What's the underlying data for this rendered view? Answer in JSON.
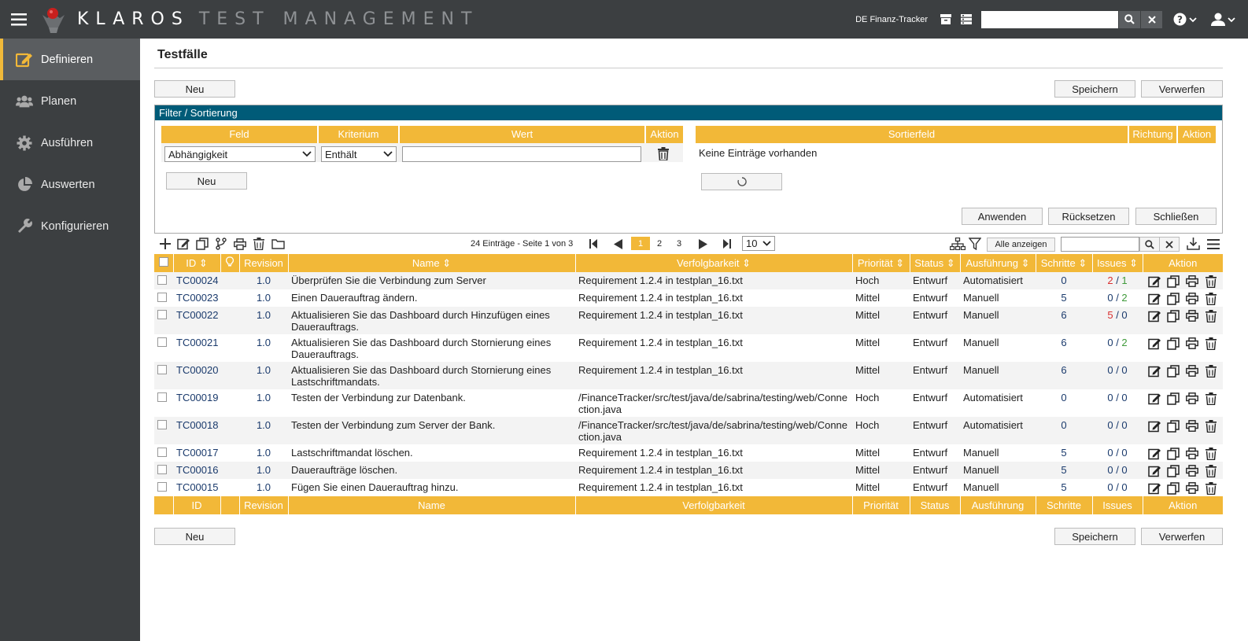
{
  "app": {
    "logo_brand": "KLAROS",
    "logo_product": "TEST MANAGEMENT",
    "project": "DE Finanz-Tracker",
    "search_value": ""
  },
  "sidebar": {
    "items": [
      {
        "label": "Definieren",
        "icon": "edit-icon",
        "active": true
      },
      {
        "label": "Planen",
        "icon": "users-icon",
        "active": false
      },
      {
        "label": "Ausführen",
        "icon": "gear-icon",
        "active": false
      },
      {
        "label": "Auswerten",
        "icon": "pie-chart-icon",
        "active": false
      },
      {
        "label": "Konfigurieren",
        "icon": "wrench-icon",
        "active": false
      }
    ]
  },
  "page": {
    "title": "Testfälle",
    "new_label": "Neu",
    "save_label": "Speichern",
    "discard_label": "Verwerfen"
  },
  "filter": {
    "header": "Filter / Sortierung",
    "col_field": "Feld",
    "col_criterion": "Kriterium",
    "col_value": "Wert",
    "col_action": "Aktion",
    "field_value": "Abhängigkeit",
    "criterion_value": "Enthält",
    "value_text": "",
    "new_label": "Neu",
    "sort_col_field": "Sortierfeld",
    "sort_col_direction": "Richtung",
    "sort_col_action": "Aktion",
    "no_entries": "Keine Einträge vorhanden",
    "apply_label": "Anwenden",
    "reset_label": "Rücksetzen",
    "close_label": "Schließen"
  },
  "pager": {
    "summary": "24 Einträge - Seite 1 von 3",
    "pages": [
      "1",
      "2",
      "3"
    ],
    "current_page": "1",
    "page_size": "10",
    "show_all_label": "Alle anzeigen",
    "table_search_value": ""
  },
  "table": {
    "headers": {
      "id": "ID",
      "revision": "Revision",
      "name": "Name",
      "traceability": "Verfolgbarkeit",
      "priority": "Priorität",
      "status": "Status",
      "execution": "Ausführung",
      "steps": "Schritte",
      "issues": "Issues",
      "action": "Aktion"
    },
    "rows": [
      {
        "id": "TC00024",
        "revision": "1.0",
        "name": "Überprüfen Sie die Verbindung zum Server",
        "traceability": "Requirement 1.2.4 in testplan_16.txt",
        "priority": "Hoch",
        "status": "Entwurf",
        "execution": "Automatisiert",
        "steps": "0",
        "issues_a": "2",
        "issues_b": "1"
      },
      {
        "id": "TC00023",
        "revision": "1.0",
        "name": "Einen Dauerauftrag ändern.",
        "traceability": "Requirement 1.2.4 in testplan_16.txt",
        "priority": "Mittel",
        "status": "Entwurf",
        "execution": "Manuell",
        "steps": "5",
        "issues_a": "0",
        "issues_b": "2"
      },
      {
        "id": "TC00022",
        "revision": "1.0",
        "name": "Aktualisieren Sie das Dashboard durch Hinzufügen eines Dauerauftrags.",
        "traceability": "Requirement 1.2.4 in testplan_16.txt",
        "priority": "Mittel",
        "status": "Entwurf",
        "execution": "Manuell",
        "steps": "6",
        "issues_a": "5",
        "issues_b": "0"
      },
      {
        "id": "TC00021",
        "revision": "1.0",
        "name": "Aktualisieren Sie das Dashboard durch Stornierung eines Dauerauftrags.",
        "traceability": "Requirement 1.2.4 in testplan_16.txt",
        "priority": "Mittel",
        "status": "Entwurf",
        "execution": "Manuell",
        "steps": "6",
        "issues_a": "0",
        "issues_b": "2"
      },
      {
        "id": "TC00020",
        "revision": "1.0",
        "name": "Aktualisieren Sie das Dashboard durch Stornierung eines Lastschriftmandats.",
        "traceability": "Requirement 1.2.4 in testplan_16.txt",
        "priority": "Mittel",
        "status": "Entwurf",
        "execution": "Manuell",
        "steps": "6",
        "issues_a": "0",
        "issues_b": "0"
      },
      {
        "id": "TC00019",
        "revision": "1.0",
        "name": "Testen der Verbindung zur Datenbank.",
        "traceability": "/FinanceTracker/src/test/java/de/sabrina/testing/web/Connection.java",
        "priority": "Hoch",
        "status": "Entwurf",
        "execution": "Automatisiert",
        "steps": "0",
        "issues_a": "0",
        "issues_b": "0"
      },
      {
        "id": "TC00018",
        "revision": "1.0",
        "name": "Testen der Verbindung zum Server der Bank.",
        "traceability": "/FinanceTracker/src/test/java/de/sabrina/testing/web/Connection.java",
        "priority": "Hoch",
        "status": "Entwurf",
        "execution": "Automatisiert",
        "steps": "0",
        "issues_a": "0",
        "issues_b": "0"
      },
      {
        "id": "TC00017",
        "revision": "1.0",
        "name": "Lastschriftmandat löschen.",
        "traceability": "Requirement 1.2.4 in testplan_16.txt",
        "priority": "Mittel",
        "status": "Entwurf",
        "execution": "Manuell",
        "steps": "5",
        "issues_a": "0",
        "issues_b": "0"
      },
      {
        "id": "TC00016",
        "revision": "1.0",
        "name": "Daueraufträge löschen.",
        "traceability": "Requirement 1.2.4 in testplan_16.txt",
        "priority": "Mittel",
        "status": "Entwurf",
        "execution": "Manuell",
        "steps": "5",
        "issues_a": "0",
        "issues_b": "0"
      },
      {
        "id": "TC00015",
        "revision": "1.0",
        "name": "Fügen Sie einen Dauerauftrag hinzu.",
        "traceability": "Requirement 1.2.4 in testplan_16.txt",
        "priority": "Mittel",
        "status": "Entwurf",
        "execution": "Manuell",
        "steps": "5",
        "issues_a": "0",
        "issues_b": "0"
      }
    ]
  },
  "colors": {
    "topbar": "#3c3f41",
    "accent": "#f2b838",
    "filter_header": "#005b78",
    "link": "#1a3a6c",
    "issue_red": "#d83030",
    "issue_green": "#3f9a3a"
  }
}
